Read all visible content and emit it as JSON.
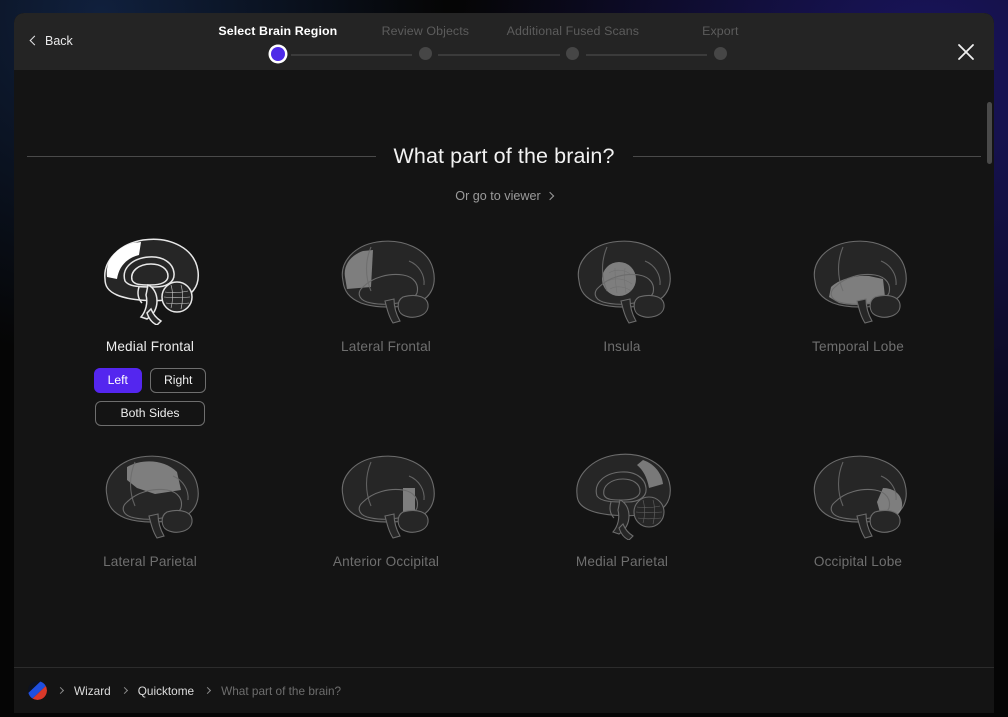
{
  "header": {
    "back_label": "Back",
    "close_icon": "close-icon",
    "steps": [
      {
        "label": "Select Brain Region",
        "state": "active"
      },
      {
        "label": "Review Objects",
        "state": "upcoming"
      },
      {
        "label": "Additional Fused Scans",
        "state": "upcoming"
      },
      {
        "label": "Export",
        "state": "upcoming"
      }
    ]
  },
  "main": {
    "title": "What part of the brain?",
    "viewer_link": "Or go to viewer",
    "regions": [
      {
        "label": "Medial Frontal",
        "view": "medial",
        "selected": true,
        "sides": [
          {
            "label": "Left",
            "active": true
          },
          {
            "label": "Right",
            "active": false
          },
          {
            "label": "Both Sides",
            "active": false
          }
        ]
      },
      {
        "label": "Lateral Frontal",
        "view": "lateral",
        "selected": false
      },
      {
        "label": "Insula",
        "view": "lateral",
        "selected": false
      },
      {
        "label": "Temporal Lobe",
        "view": "lateral",
        "selected": false
      },
      {
        "label": "Lateral Parietal",
        "view": "lateral",
        "selected": false
      },
      {
        "label": "Anterior Occipital",
        "view": "lateral",
        "selected": false
      },
      {
        "label": "Medial Parietal",
        "view": "medial",
        "selected": false
      },
      {
        "label": "Occipital Lobe",
        "view": "lateral",
        "selected": false
      }
    ]
  },
  "footer": {
    "logo_icon": "brand-logo-icon",
    "breadcrumbs": [
      {
        "label": "Wizard",
        "current": false
      },
      {
        "label": "Quicktome",
        "current": false
      },
      {
        "label": "What part of the brain?",
        "current": true
      }
    ]
  },
  "colors": {
    "accent": "#5426ef",
    "modal_bg": "#141414",
    "header_bg": "#242424",
    "active_step_dot": "#4d2ae8",
    "muted_text": "#6f6f6f",
    "brain_outline": "#6c6c6c",
    "brain_fill": "#262626",
    "brain_highlight": "#8e8e8e",
    "selected_outline": "#e8e8e8",
    "selected_highlight": "#ffffff"
  }
}
